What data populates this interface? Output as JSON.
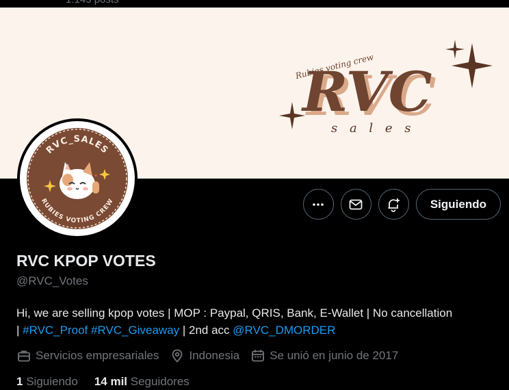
{
  "header": {
    "posts_text": "1.143 posts"
  },
  "banner": {
    "script_text": "Rubies voting crew",
    "logo_text": "RVC",
    "sub_text": "s a l e s"
  },
  "avatar": {
    "top_text": "RVC_SALES",
    "bottom_text": "RUBIES VOTING CREW"
  },
  "actions": {
    "follow_label": "Siguiendo"
  },
  "profile": {
    "name": "RVC KPOP VOTES",
    "handle": "@RVC_Votes",
    "bio_line1": "Hi, we are selling kpop votes | MOP : Paypal, QRIS, Bank, E-Wallet | No cancellation",
    "bio_sep": "| ",
    "bio_tag1": "#RVC_Proof",
    "bio_tag2": "#RVC_Giveaway",
    "bio_mid": " | 2nd acc ",
    "bio_mention": "@RVC_DMORDER"
  },
  "meta": {
    "category": "Servicios empresariales",
    "location": "Indonesia",
    "joined": "Se unió en junio de 2017"
  },
  "stats": {
    "following_count": "1",
    "following_label": "Siguiendo",
    "followers_count": "14 mil",
    "followers_label": "Seguidores"
  }
}
